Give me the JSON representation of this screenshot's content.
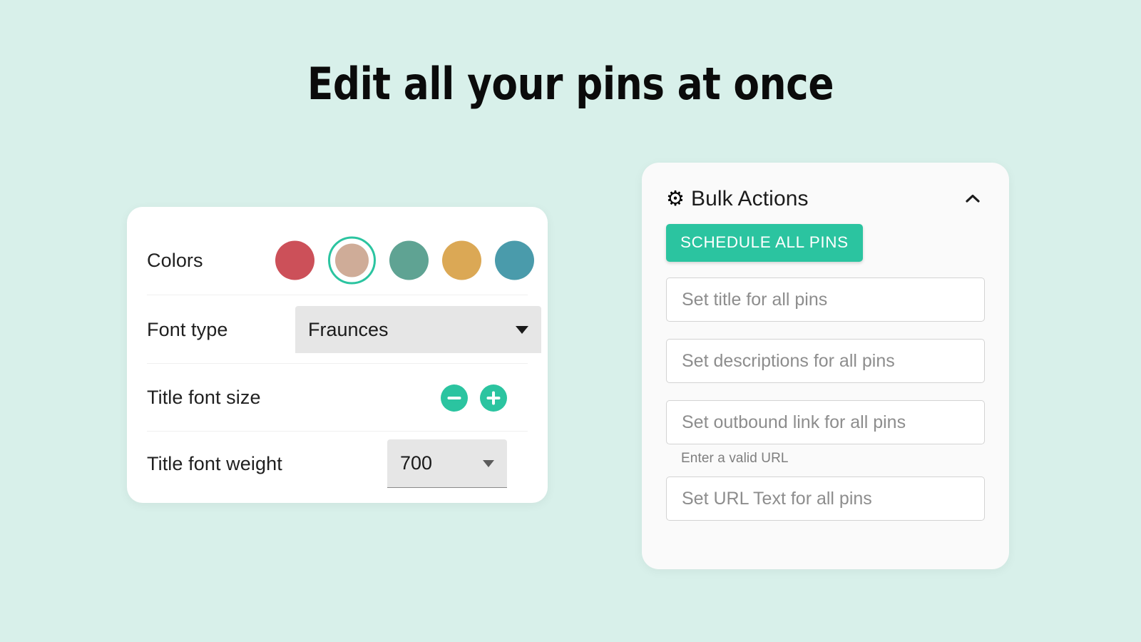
{
  "page": {
    "headline": "Edit all your pins at once",
    "background_color": "#d8f0ea",
    "accent_color": "#2bc4a0"
  },
  "settings_card": {
    "colors_row": {
      "label": "Colors",
      "swatches": [
        {
          "name": "red",
          "hex": "#cc5059",
          "selected": false
        },
        {
          "name": "tan",
          "hex": "#cfac98",
          "selected": true
        },
        {
          "name": "green",
          "hex": "#5fa393",
          "selected": false
        },
        {
          "name": "gold",
          "hex": "#dba855",
          "selected": false
        },
        {
          "name": "blue",
          "hex": "#4a9bab",
          "selected": false
        }
      ]
    },
    "font_type_row": {
      "label": "Font type",
      "value": "Fraunces"
    },
    "font_size_row": {
      "label": "Title font size",
      "decrease_label": "−",
      "increase_label": "+"
    },
    "font_weight_row": {
      "label": "Title font weight",
      "value": "700"
    }
  },
  "bulk_actions_panel": {
    "gear_icon": "⚙",
    "title": "Bulk Actions",
    "collapse_icon": "chevron-up-icon",
    "schedule_button": "SCHEDULE ALL PINS",
    "fields": [
      {
        "name": "title",
        "placeholder": "Set title for all pins",
        "value": "",
        "helper": ""
      },
      {
        "name": "descriptions",
        "placeholder": "Set descriptions for all pins",
        "value": "",
        "helper": ""
      },
      {
        "name": "outbound-link",
        "placeholder": "Set outbound link for all pins",
        "value": "",
        "helper": "Enter a valid URL"
      },
      {
        "name": "url-text",
        "placeholder": "Set URL Text for all pins",
        "value": "",
        "helper": ""
      }
    ]
  }
}
